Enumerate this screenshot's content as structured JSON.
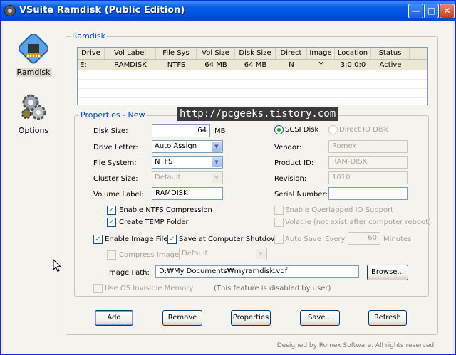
{
  "window": {
    "title": "VSuite Ramdisk (Public Edition)"
  },
  "sidebar": {
    "items": [
      {
        "label": "Ramdisk",
        "icon": "ramdisk-chip-icon",
        "selected": true
      },
      {
        "label": "Options",
        "icon": "gears-icon",
        "selected": false
      }
    ]
  },
  "ramdisk_group": {
    "label": "Ramdisk"
  },
  "table": {
    "columns": [
      "Drive",
      "Vol Label",
      "File Sys",
      "Vol Size",
      "Disk Size",
      "Direct",
      "Image",
      "Location",
      "Status"
    ],
    "rows": [
      {
        "drive": "E:",
        "vol_label": "RAMDISK",
        "file_sys": "NTFS",
        "vol_size": "64 MB",
        "disk_size": "64 MB",
        "direct": "N",
        "image": "Y",
        "location": "3:0:0:0",
        "status": "Active"
      }
    ]
  },
  "watermark": "http://pcgeeks.tistory.com",
  "properties": {
    "label": "Properties - New",
    "disk_size_label": "Disk Size:",
    "disk_size_value": "64",
    "disk_size_unit": "MB",
    "drive_letter_label": "Drive Letter:",
    "drive_letter_value": "Auto Assign",
    "file_system_label": "File System:",
    "file_system_value": "NTFS",
    "cluster_size_label": "Cluster Size:",
    "cluster_size_value": "Default",
    "volume_label_label": "Volume Label:",
    "volume_label_value": "RAMDISK",
    "enable_ntfs_compression": "Enable NTFS Compression",
    "create_temp_folder": "Create TEMP Folder",
    "enable_image_file": "Enable Image File",
    "save_at_shutdown": "Save at Computer Shutdown",
    "compress_image": "Compress Image",
    "compress_image_value": "Default",
    "image_path_label": "Image Path:",
    "image_path_value": "D:₩My Documents₩myramdisk.vdf",
    "browse_label": "Browse...",
    "use_os_invisible_memory": "Use OS Invisible Memory",
    "disabled_note": "(This feature is disabled by user)",
    "scsi_disk": "SCSI Disk",
    "direct_io_disk": "Direct IO Disk",
    "vendor_label": "Vendor:",
    "vendor_value": "Romex",
    "product_id_label": "Product ID:",
    "product_id_value": "RAM-DISK",
    "revision_label": "Revision:",
    "revision_value": "1010",
    "serial_number_label": "Serial Number:",
    "serial_number_value": "",
    "enable_overlapped_io": "Enable Overlapped IO Support",
    "volatile": "Volatile (not exist after computer reboot)",
    "auto_save": "Auto Save",
    "every_label": "Every",
    "every_value": "60",
    "minutes_label": "Minutes"
  },
  "buttons": {
    "add": "Add",
    "remove": "Remove",
    "properties": "Properties",
    "save": "Save...",
    "refresh": "Refresh"
  },
  "footer": "Designed by Romex Software. All rights reserved."
}
